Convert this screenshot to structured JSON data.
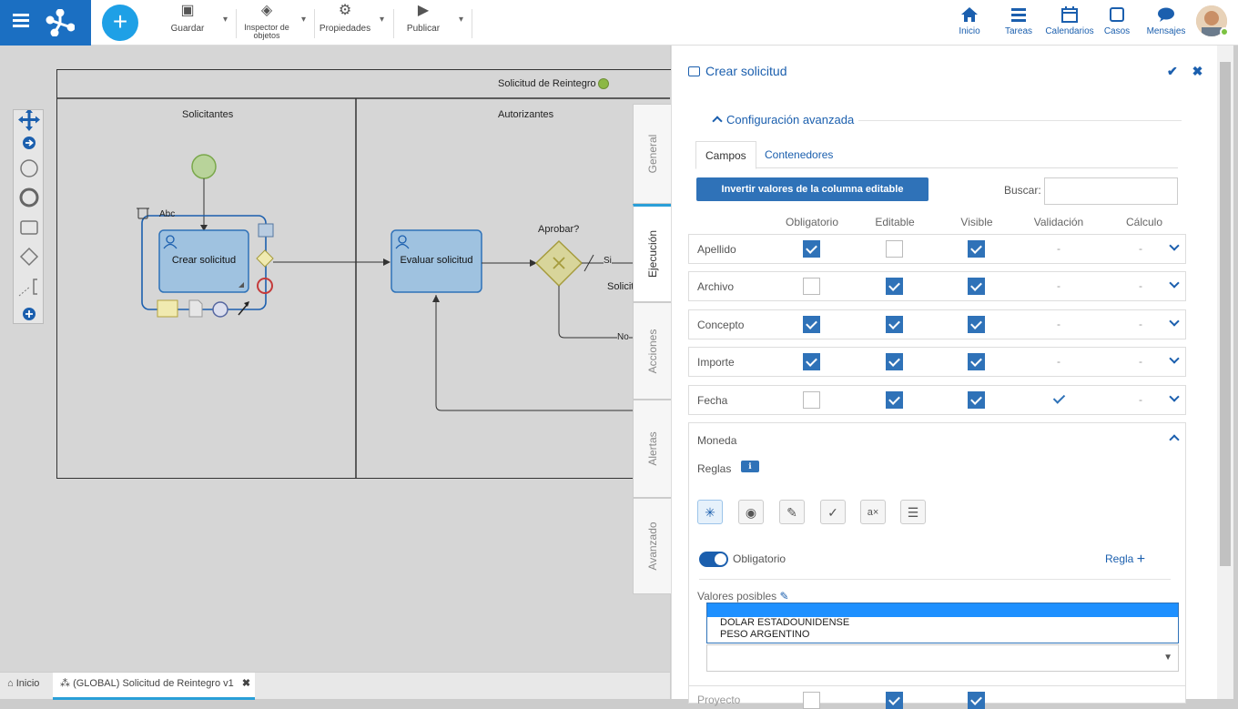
{
  "toolbar": {
    "save": "Guardar",
    "inspector": "Inspector de objetos",
    "properties": "Propiedades",
    "publish": "Publicar"
  },
  "nav": {
    "home": "Inicio",
    "tasks": "Tareas",
    "calendars": "Calendarios",
    "cases": "Casos",
    "messages": "Mensajes"
  },
  "diagram": {
    "pool_title": "Solicitud de Reintegro",
    "lane1": "Solicitantes",
    "lane2": "Autorizantes",
    "task1": "Crear solicitud",
    "task2": "Evaluar solicitud",
    "gateway": "Aprobar?",
    "flow_yes": "Si",
    "flow_no": "No",
    "flow_label_cut": "Solicit",
    "text_annot": "Abc"
  },
  "side_tabs": [
    "General",
    "Ejecución",
    "Acciones",
    "Alertas",
    "Avanzado"
  ],
  "panel": {
    "title": "Crear solicitud",
    "section": "Configuración avanzada",
    "tab_fields": "Campos",
    "tab_containers": "Contenedores",
    "invert_btn": "Invertir valores de la columna editable",
    "search_label": "Buscar:",
    "search_value": "",
    "columns": [
      "Obligatorio",
      "Editable",
      "Visible",
      "Validación",
      "Cálculo"
    ],
    "rows": [
      {
        "name": "Apellido",
        "req": true,
        "edit": false,
        "vis": true,
        "val": "-",
        "calc": "-"
      },
      {
        "name": "Archivo",
        "req": false,
        "edit": true,
        "vis": true,
        "val": "-",
        "calc": "-"
      },
      {
        "name": "Concepto",
        "req": true,
        "edit": true,
        "vis": true,
        "val": "-",
        "calc": "-"
      },
      {
        "name": "Importe",
        "req": true,
        "edit": true,
        "vis": true,
        "val": "-",
        "calc": "-"
      },
      {
        "name": "Fecha",
        "req": false,
        "edit": true,
        "vis": true,
        "val": "check",
        "calc": "-"
      }
    ],
    "expanded": {
      "name": "Moneda",
      "rules_label": "Reglas",
      "toggle_label": "Obligatorio",
      "add_rule": "Regla",
      "values_label": "Valores posibles",
      "options": [
        "",
        "DOLAR ESTADOUNIDENSE",
        "PESO ARGENTINO"
      ],
      "selected": ""
    },
    "partial_row": "Proyecto"
  },
  "bottom": {
    "home_tab": "Inicio",
    "doc_tab": "(GLOBAL) Solicitud de Reintegro v1"
  }
}
